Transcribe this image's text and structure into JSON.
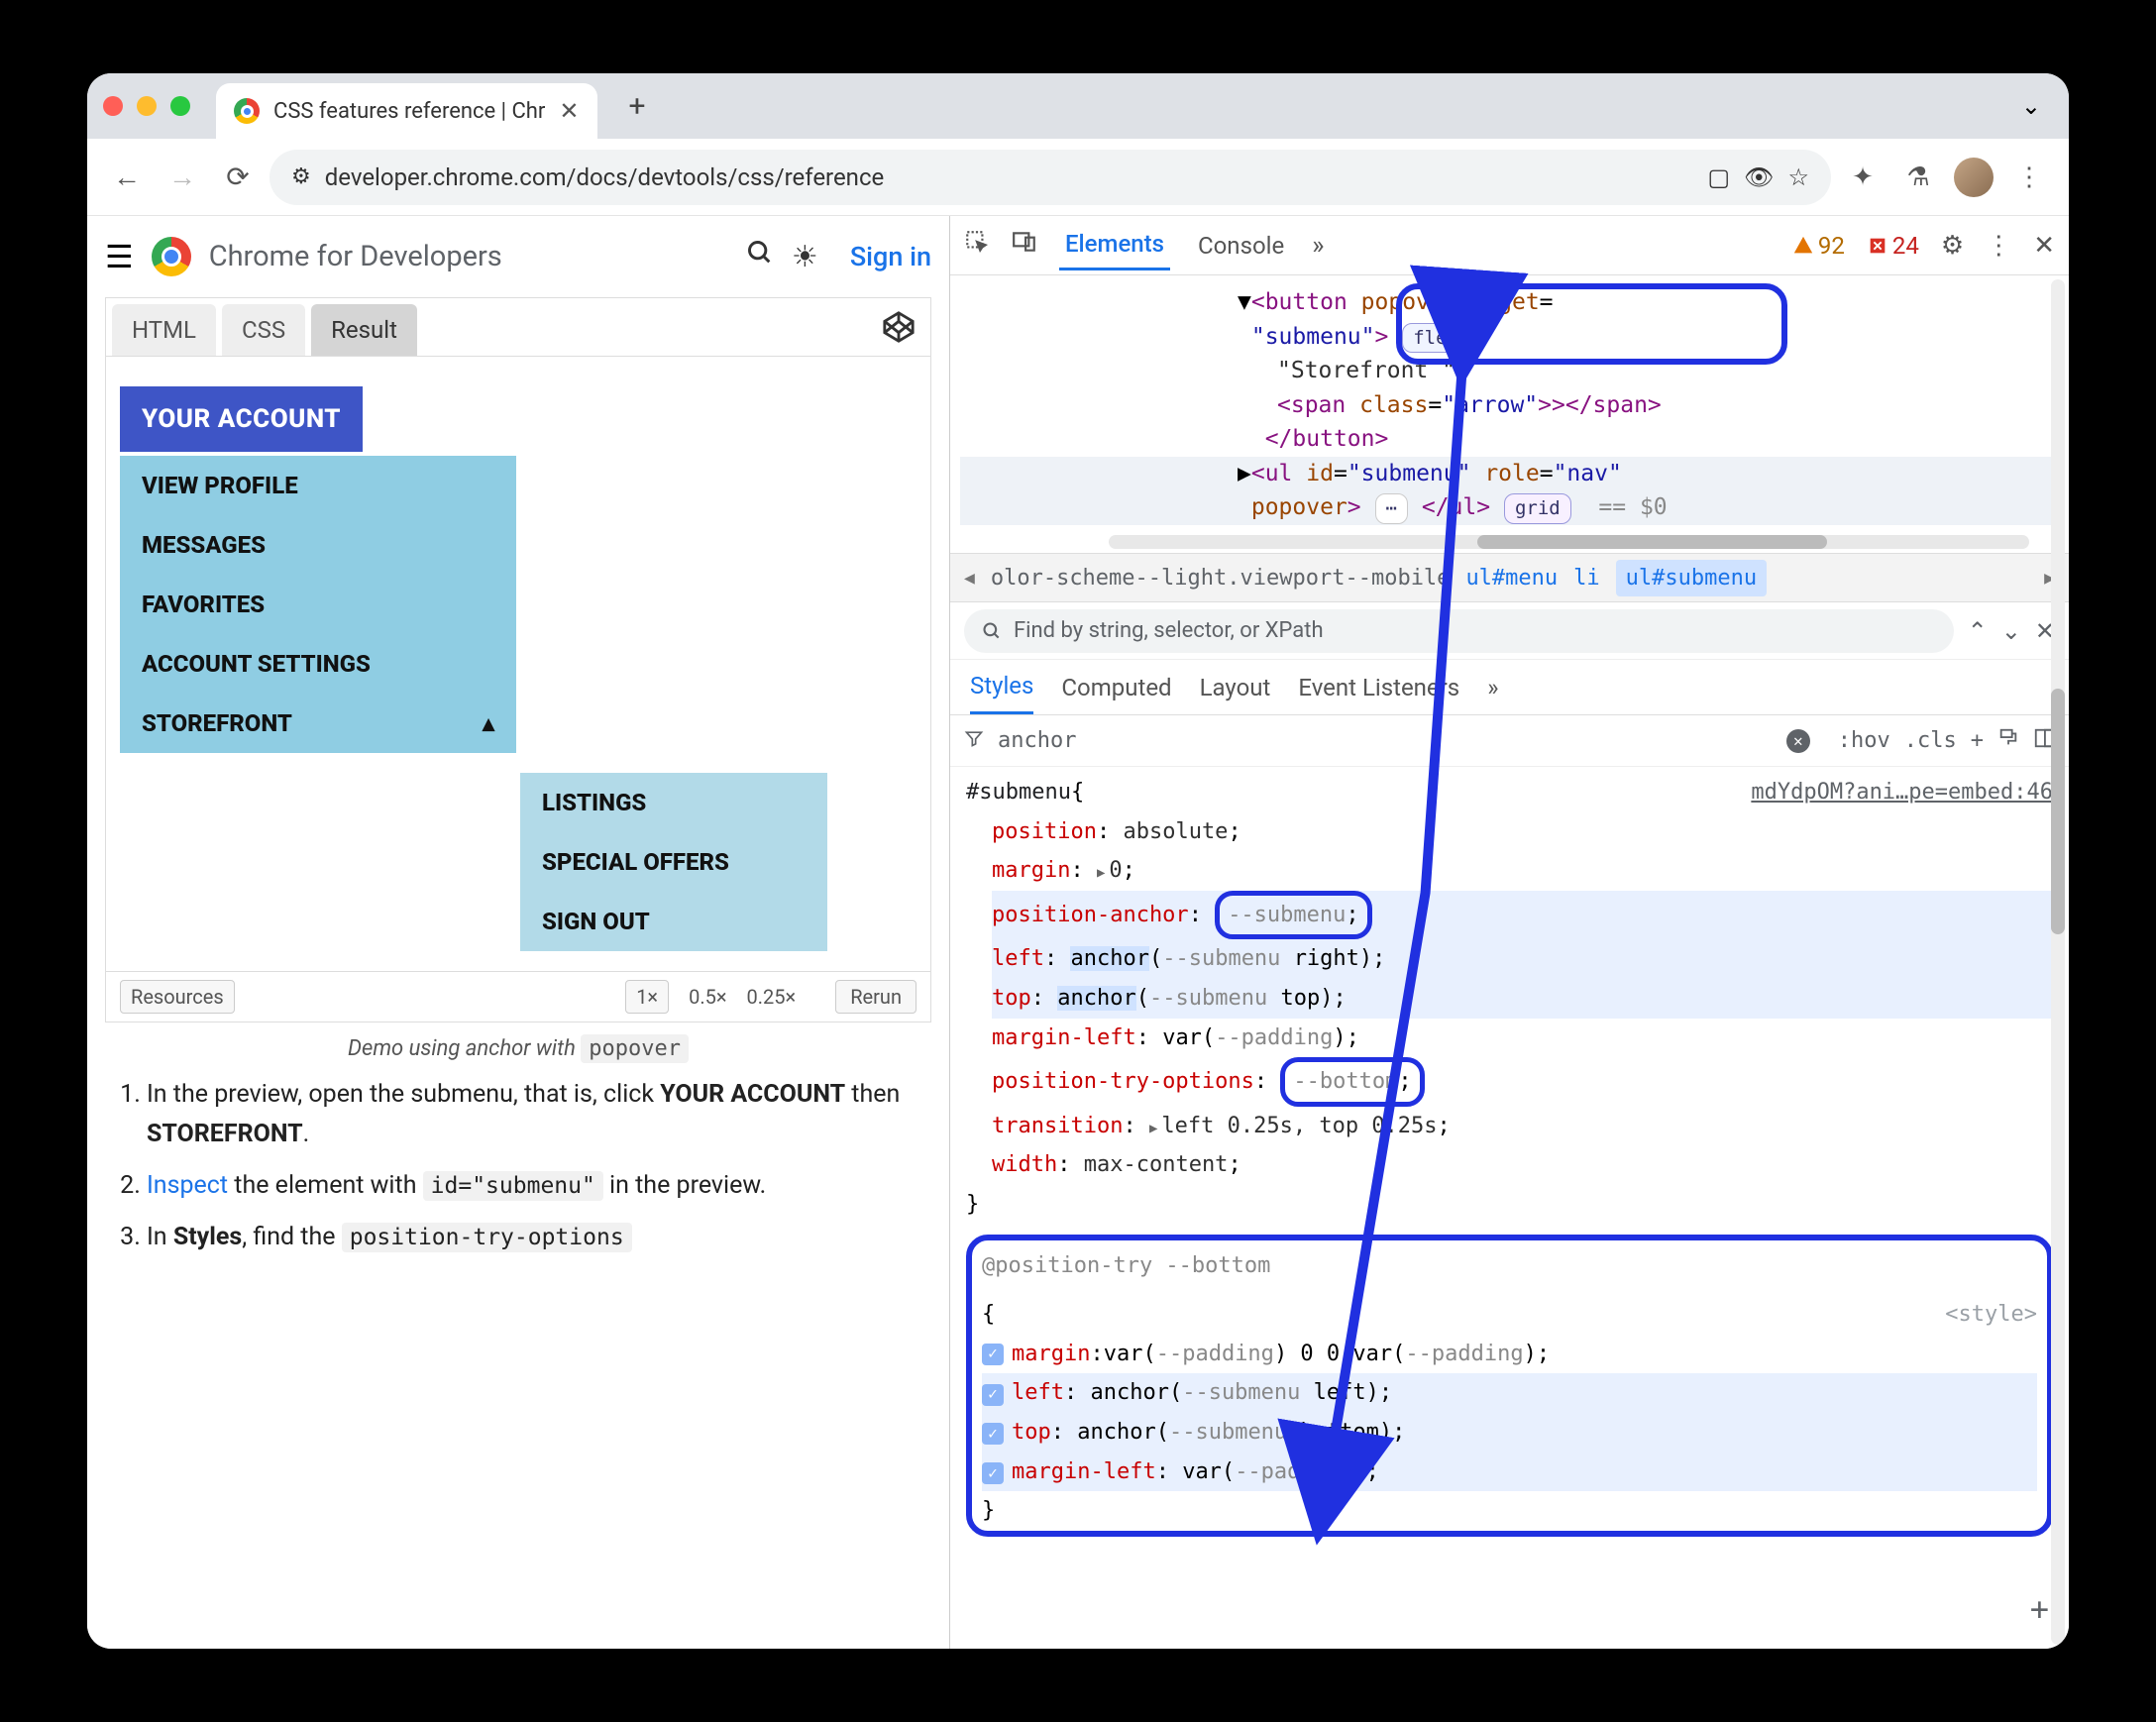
{
  "tab": {
    "title": "CSS features reference  |  Chr"
  },
  "url": "developer.chrome.com/docs/devtools/css/reference",
  "page_header": {
    "brand": "Chrome for Developers",
    "signin": "Sign in"
  },
  "frame": {
    "tabs": [
      "HTML",
      "CSS",
      "Result"
    ],
    "account_button": "YOUR ACCOUNT",
    "menu1": [
      "VIEW PROFILE",
      "MESSAGES",
      "FAVORITES",
      "ACCOUNT SETTINGS",
      "STOREFRONT"
    ],
    "menu2": [
      "LISTINGS",
      "SPECIAL OFFERS",
      "SIGN OUT"
    ],
    "resources": "Resources",
    "zooms": [
      "1×",
      "0.5×",
      "0.25×"
    ],
    "rerun": "Rerun"
  },
  "caption": {
    "text": "Demo using anchor with ",
    "code": "popover"
  },
  "steps": [
    {
      "pre": "In the preview, open the submenu, that is, click ",
      "b1": "YOUR ACCOUNT",
      "mid": " then ",
      "b2": "STOREFRONT",
      "post": "."
    },
    {
      "link": "Inspect",
      "t1": " the element with ",
      "code": "id=\"submenu\"",
      "t2": " in the preview."
    },
    {
      "t1": "In ",
      "b": "Styles",
      "t2": ", find the ",
      "code": "position-try-options"
    }
  ],
  "devtools": {
    "tabs": {
      "elements": "Elements",
      "console": "Console"
    },
    "warn_count": "92",
    "err_count": "24",
    "dom": {
      "l1a": "<button",
      "l1b": "popovertarget",
      "l1c": "=",
      "l2a": "\"submenu\"",
      "l2b": ">",
      "flex": "flex",
      "l3": "\"Storefront \"",
      "l4a": "<span",
      "l4b": "class",
      "l4c": "\"arrow\"",
      "l4d": ">></span>",
      "l5": "</button>",
      "l6a": "<ul",
      "l6b": "id",
      "l6c": "\"submenu\"",
      "l6d": "role",
      "l6e": "\"nav\"",
      "l7a": "popover",
      "l7b": ">",
      "dots": "⋯",
      "l7c": "</ul>",
      "grid": "grid",
      "eq": "== $0"
    },
    "crumb": {
      "c1": "olor-scheme--light.viewport--mobile",
      "c2": "ul#menu",
      "c3": "li",
      "c4": "ul#submenu"
    },
    "filter_placeholder": "Find by string, selector, or XPath",
    "styles_tabs": [
      "Styles",
      "Computed",
      "Layout",
      "Event Listeners"
    ],
    "filter_value": "anchor",
    "hov": ":hov",
    "cls": ".cls",
    "rule": {
      "selector": "#submenu",
      "source": "mdYdpOM?ani…pe=embed:46",
      "props": [
        {
          "name": "position",
          "value": "absolute"
        },
        {
          "name": "margin",
          "value": "0",
          "tri": true
        },
        {
          "name": "position-anchor",
          "var": "--submenu",
          "hlvar": true,
          "rowhl": true
        },
        {
          "name": "left",
          "anchor": true,
          "anchorvar": "--submenu",
          "side": "right",
          "rowhl": true
        },
        {
          "name": "top",
          "anchor": true,
          "anchorvar": "--submenu",
          "side": "top",
          "rowhl": true
        },
        {
          "name": "margin-left",
          "varfn": "--padding"
        },
        {
          "name": "position-try-options",
          "var": "--bottom",
          "hlvar": true
        },
        {
          "name": "transition",
          "value": "left 0.25s, top 0.25s",
          "tri": true
        },
        {
          "name": "width",
          "value": "max-content"
        }
      ]
    },
    "ptry": {
      "header": "@position-try --bottom",
      "style_src": "<style>",
      "rows": [
        {
          "name": "margin",
          "raw": "var(--padding) 0 0 var(--padding)",
          "tri": true
        },
        {
          "name": "left",
          "anchor": "--submenu",
          "side": "left",
          "hl": true
        },
        {
          "name": "top",
          "anchor": "--submenu",
          "side": "bottom",
          "hl": true
        },
        {
          "name": "margin-left",
          "varfn": "--padding",
          "hl": true
        }
      ]
    }
  }
}
